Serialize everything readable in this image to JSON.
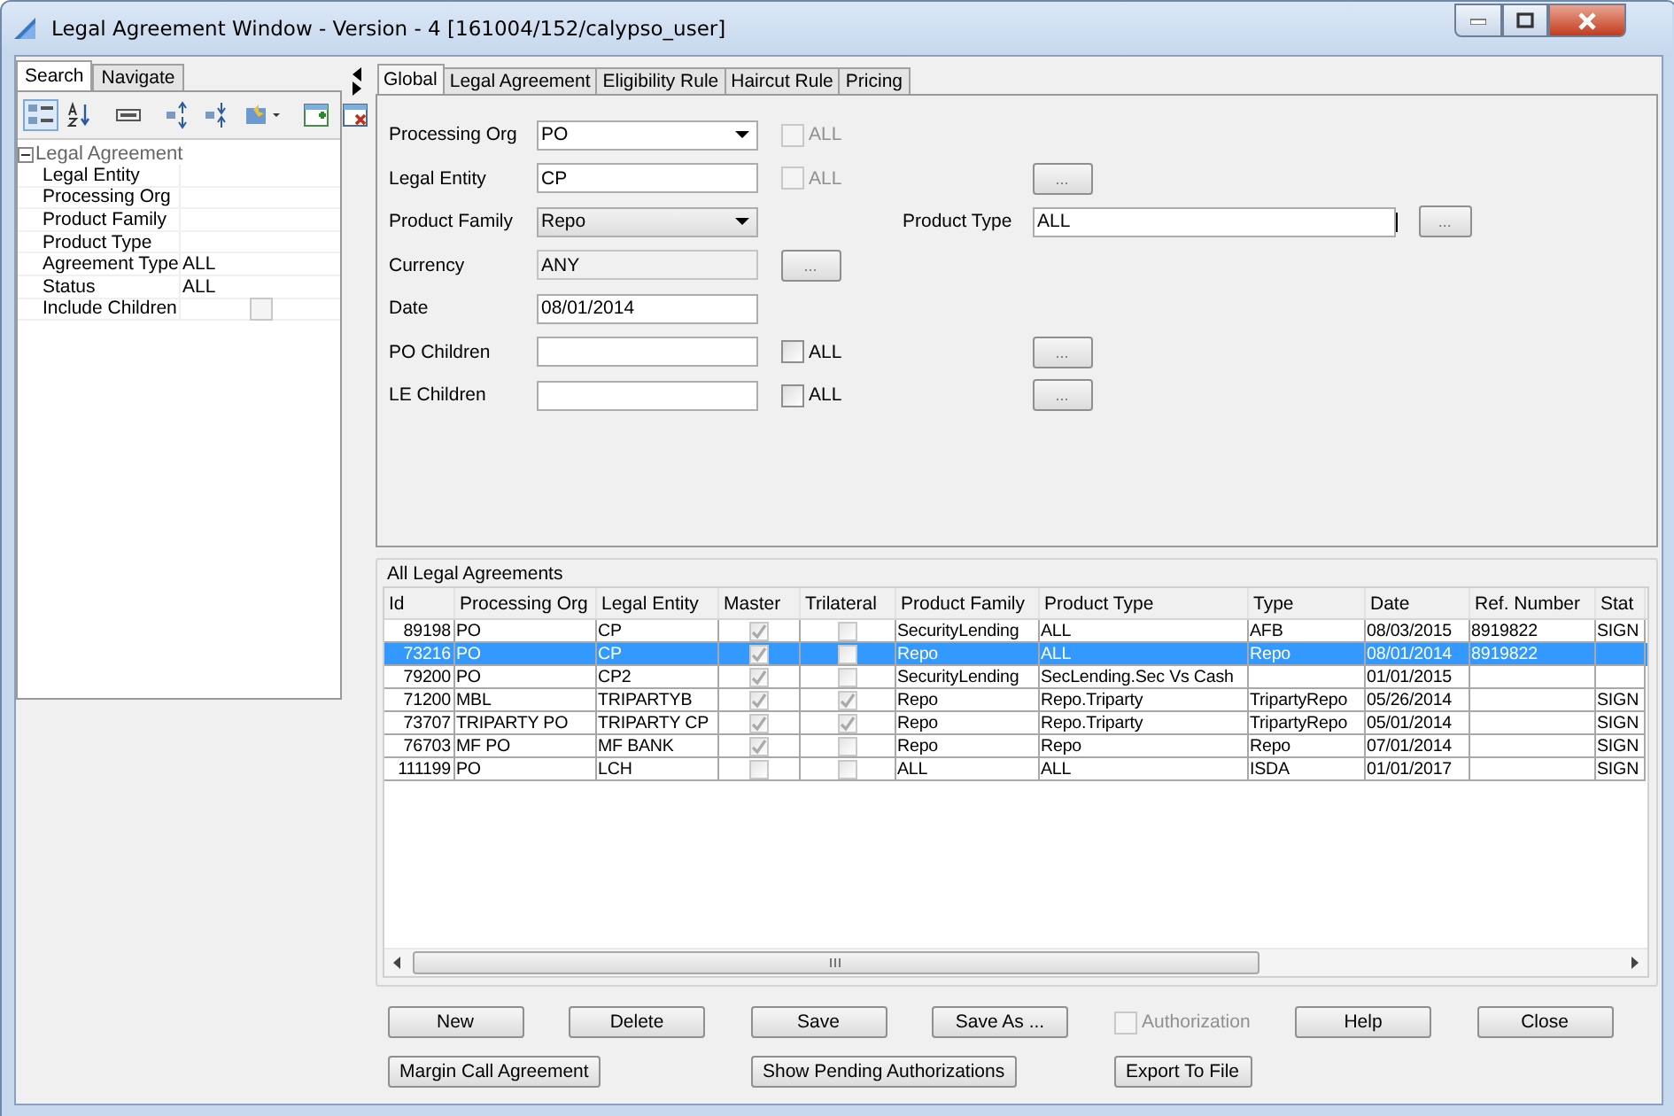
{
  "window": {
    "title": "Legal Agreement Window - Version - 4 [161004/152/calypso_user]"
  },
  "search_panel": {
    "tabs": [
      {
        "label": "Search",
        "selected": true
      },
      {
        "label": "Navigate",
        "selected": false
      }
    ],
    "toolbar": [
      {
        "kind": "categorized",
        "selected": true
      },
      {
        "kind": "sort",
        "selected": false
      },
      {
        "kind": "property",
        "selected": false
      },
      {
        "kind": "expand",
        "selected": false
      },
      {
        "kind": "collapse",
        "selected": false
      },
      {
        "kind": "starmenu",
        "selected": false
      },
      {
        "kind": "add",
        "selected": false
      },
      {
        "kind": "remove",
        "selected": false
      }
    ],
    "group": {
      "label": "Legal Agreement",
      "expanded": true,
      "rows": [
        {
          "kind": "text",
          "label": "Legal Entity"
        },
        {
          "kind": "text",
          "label": "Processing Org"
        },
        {
          "kind": "text",
          "label": "Product Family"
        },
        {
          "kind": "text",
          "label": "Product Type"
        },
        {
          "kind": "text",
          "label": "Agreement Type",
          "value": "ALL"
        },
        {
          "kind": "text",
          "label": "Status",
          "value": "ALL"
        },
        {
          "kind": "checkbox",
          "label": "Include Children",
          "checked": false
        }
      ]
    }
  },
  "form": {
    "tabs": [
      {
        "label": "Global",
        "selected": true
      },
      {
        "label": "Legal Agreement",
        "selected": false
      },
      {
        "label": "Eligibility Rule",
        "selected": false
      },
      {
        "label": "Haircut Rule",
        "selected": false
      },
      {
        "label": "Pricing",
        "selected": false
      }
    ],
    "fields": [
      {
        "label": "Processing Org",
        "kind": "dropdown",
        "editable": true,
        "value": "PO",
        "all_checkbox": {
          "label": "ALL",
          "checked": false,
          "disabled": true
        }
      },
      {
        "label": "Legal Entity",
        "kind": "text",
        "disabled": false,
        "value": "CP",
        "all_checkbox": {
          "label": "ALL",
          "checked": false,
          "disabled": true
        },
        "button": "..."
      },
      {
        "label": "Product  Family",
        "kind": "dropdown",
        "editable": false,
        "value": "Repo",
        "side_field": {
          "label": "Product Type",
          "value": "ALL",
          "button": "..."
        }
      },
      {
        "label": "Currency",
        "kind": "text",
        "disabled": true,
        "value": "ANY",
        "button": "..."
      },
      {
        "label": "Date",
        "kind": "text",
        "disabled": false,
        "value": "08/01/2014"
      },
      {
        "label": "PO Children",
        "kind": "text",
        "disabled": false,
        "all_checkbox": {
          "label": "ALL",
          "checked": false,
          "disabled": false
        },
        "button": "..."
      },
      {
        "label": "LE Children",
        "kind": "text",
        "disabled": false,
        "all_checkbox": {
          "label": "ALL",
          "checked": false,
          "disabled": false
        },
        "button": "..."
      }
    ]
  },
  "agreements": {
    "title": "All Legal Agreements",
    "columns": [
      "Id",
      "Processing Org",
      "Legal Entity",
      "Master",
      "Trilateral",
      "Product Family",
      "Product Type",
      "Type",
      "Date",
      "Ref. Number",
      "Stat"
    ],
    "rows": [
      {
        "selected": false,
        "id": "89198",
        "processing_org": "PO",
        "legal_entity": "CP",
        "master": true,
        "trilateral": false,
        "product_family": "SecurityLending",
        "product_type": "ALL",
        "type": "AFB",
        "date": "08/03/2015",
        "ref_number": "8919822",
        "status": "SIGN"
      },
      {
        "selected": true,
        "id": "73216",
        "processing_org": "PO",
        "legal_entity": "CP",
        "master": true,
        "trilateral": false,
        "product_family": "Repo",
        "product_type": "ALL",
        "type": "Repo",
        "date": "08/01/2014",
        "ref_number": "8919822"
      },
      {
        "selected": false,
        "id": "79200",
        "processing_org": "PO",
        "legal_entity": "CP2",
        "master": true,
        "trilateral": false,
        "product_family": "SecurityLending",
        "product_type": "SecLending.Sec Vs Cash",
        "date": "01/01/2015"
      },
      {
        "selected": false,
        "id": "71200",
        "processing_org": "MBL",
        "legal_entity": "TRIPARTYB",
        "master": true,
        "trilateral": true,
        "product_family": "Repo",
        "product_type": "Repo.Triparty",
        "type": "TripartyRepo",
        "date": "05/26/2014",
        "status": "SIGN"
      },
      {
        "selected": false,
        "id": "73707",
        "processing_org": "TRIPARTY PO",
        "legal_entity": "TRIPARTY CP",
        "master": true,
        "trilateral": true,
        "product_family": "Repo",
        "product_type": "Repo.Triparty",
        "type": "TripartyRepo",
        "date": "05/01/2014",
        "status": "SIGN"
      },
      {
        "selected": false,
        "id": "76703",
        "processing_org": "MF PO",
        "legal_entity": "MF BANK",
        "master": true,
        "trilateral": false,
        "product_family": "Repo",
        "product_type": "Repo",
        "type": "Repo",
        "date": "07/01/2014",
        "status": "SIGN"
      },
      {
        "selected": false,
        "id": "111199",
        "processing_org": "PO",
        "legal_entity": "LCH",
        "master": false,
        "trilateral": false,
        "product_family": "ALL",
        "product_type": "ALL",
        "type": "ISDA",
        "date": "01/01/2017",
        "status": "SIGN"
      }
    ]
  },
  "actions": [
    [
      {
        "kind": "button",
        "label": "New"
      },
      {
        "kind": "button",
        "label": "Delete"
      },
      {
        "kind": "button",
        "label": "Save"
      },
      {
        "kind": "button",
        "label": "Save As ..."
      },
      {
        "kind": "checkbox",
        "label": "Authorization",
        "checked": false,
        "disabled": true
      },
      {
        "kind": "button",
        "label": "Help"
      },
      {
        "kind": "button",
        "label": "Close"
      }
    ],
    [
      {
        "kind": "button",
        "label": "Margin Call Agreement"
      },
      {
        "kind": "button",
        "label": "Show Pending Authorizations"
      },
      {
        "kind": "button",
        "label": "Export To File"
      }
    ]
  ]
}
